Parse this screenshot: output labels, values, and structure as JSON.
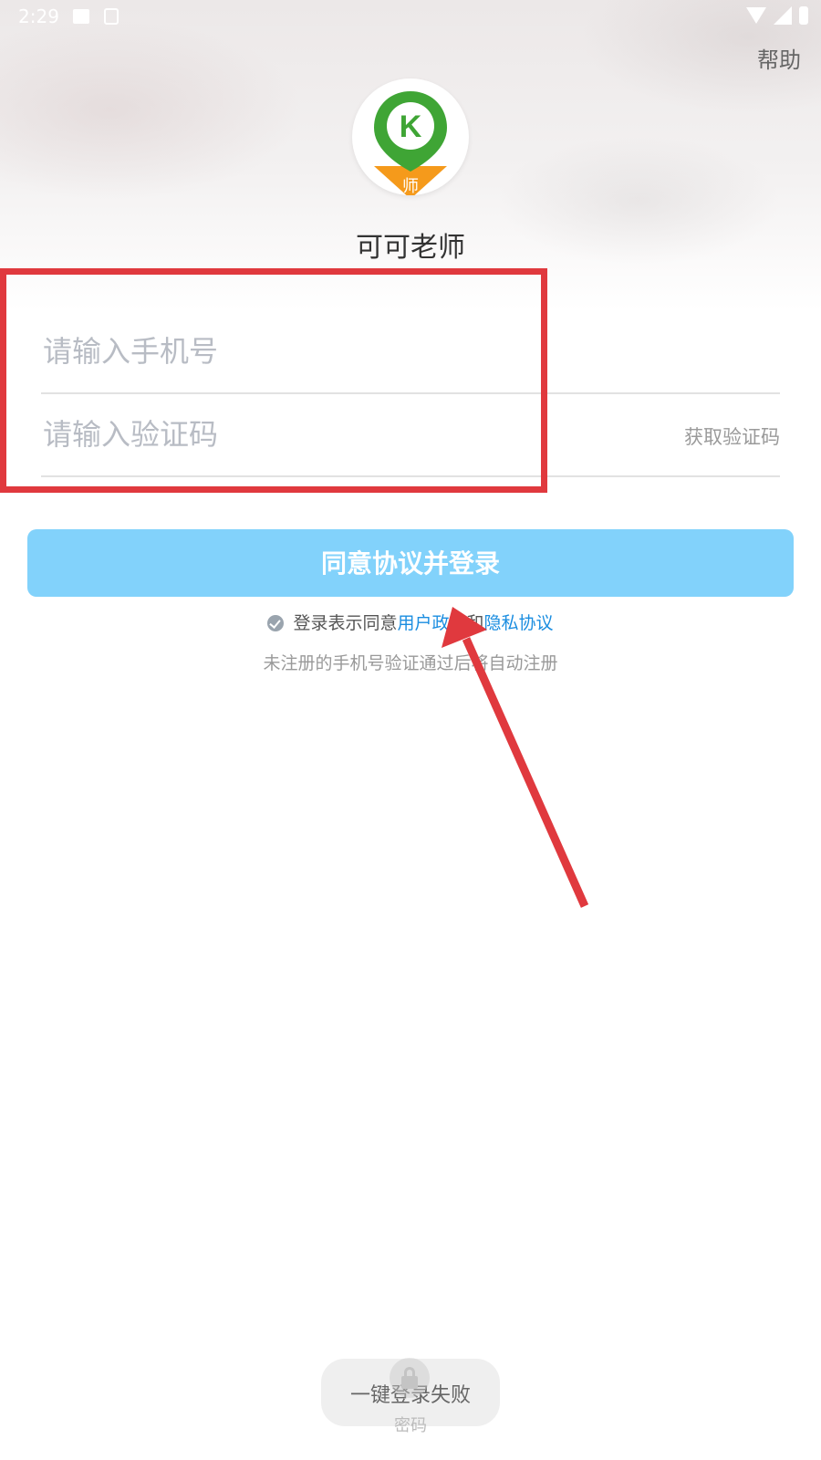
{
  "status_bar": {
    "time": "2:29"
  },
  "header": {
    "help_label": "帮助"
  },
  "app": {
    "name": "可可老师",
    "logo_badge": "师",
    "logo_letter": "K"
  },
  "form": {
    "phone_placeholder": "请输入手机号",
    "code_placeholder": "请输入验证码",
    "get_code_label": "获取验证码",
    "login_label": "同意协议并登录"
  },
  "agreement": {
    "prefix": "登录表示同意",
    "user_policy": "用户政策",
    "and": "和",
    "privacy_policy": "隐私协议"
  },
  "register_note": "未注册的手机号验证通过后将自动注册",
  "toast": {
    "message": "一键登录失败"
  },
  "password_label": "密码",
  "colors": {
    "button": "#82d2fb",
    "link": "#1a8de0",
    "annotation": "#e0393e",
    "logo_green": "#3fa535",
    "logo_orange": "#f59a1b"
  },
  "icons": [
    "image-icon",
    "a-icon",
    "wifi-icon",
    "signal-icon",
    "battery-icon",
    "check-icon",
    "lock-icon"
  ]
}
